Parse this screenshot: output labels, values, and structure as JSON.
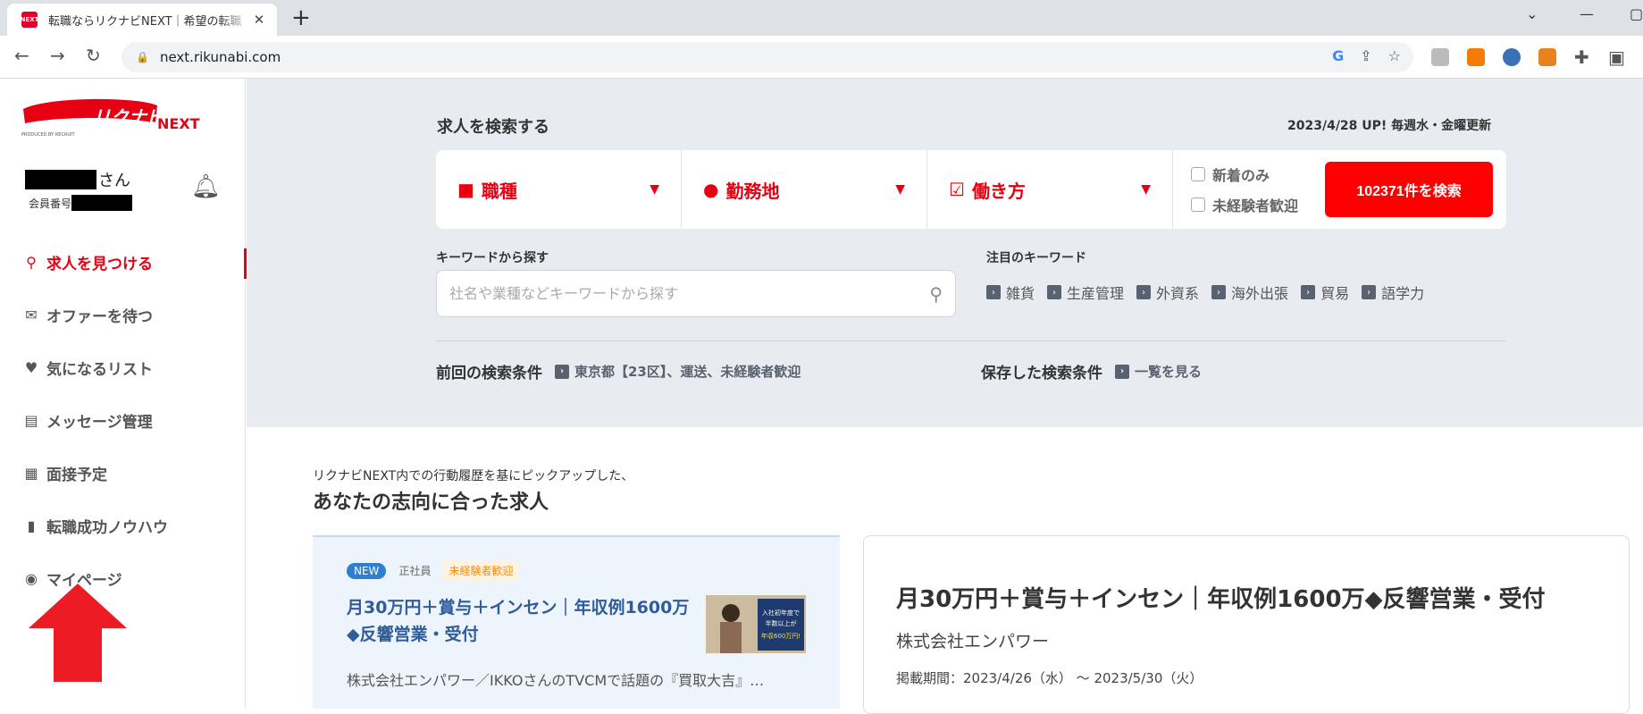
{
  "browser": {
    "tab_favicon_text": "NEXT",
    "tab_title": "転職ならリクナビNEXT｜希望の転職",
    "tab_close": "✕",
    "new_tab": "+",
    "url": "next.rikunabi.com"
  },
  "sidebar": {
    "logo_text": "リクナビ",
    "logo_suffix": "NEXT",
    "logo_tag": "PRODUCED BY RECRUIT",
    "user_suffix": "さん",
    "member_label": "会員番号",
    "menu": [
      {
        "label": "求人を見つける",
        "icon": "search-icon",
        "active": true
      },
      {
        "label": "オファーを待つ",
        "icon": "mail-icon",
        "active": false
      },
      {
        "label": "気になるリスト",
        "icon": "heart-icon",
        "active": false
      },
      {
        "label": "メッセージ管理",
        "icon": "message-icon",
        "active": false
      },
      {
        "label": "面接予定",
        "icon": "calendar-icon",
        "active": false
      },
      {
        "label": "転職成功ノウハウ",
        "icon": "book-icon",
        "active": false
      },
      {
        "label": "マイページ",
        "icon": "user-icon",
        "active": false
      }
    ]
  },
  "search": {
    "heading": "求人を検索する",
    "update_note": "2023/4/28 UP! 毎週水・金曜更新",
    "selectors": [
      {
        "label": "職種",
        "icon": "briefcase-icon"
      },
      {
        "label": "勤務地",
        "icon": "location-pin-icon"
      },
      {
        "label": "働き方",
        "icon": "clipboard-check-icon"
      }
    ],
    "checks": [
      "新着のみ",
      "未経験者歓迎"
    ],
    "button": "102371件を検索",
    "keyword_label": "キーワードから探す",
    "keyword_placeholder": "社名や業種などキーワードから探す",
    "hot_label": "注目のキーワード",
    "hot_keywords": [
      "雑貨",
      "生産管理",
      "外資系",
      "海外出張",
      "貿易",
      "語学力"
    ],
    "prev_label": "前回の検索条件",
    "prev_value": "東京都【23区】、運送、未経験者歓迎",
    "saved_label": "保存した検索条件",
    "saved_link": "一覧を見る"
  },
  "recommend": {
    "subtitle": "リクナビNEXT内での行動履歴を基にピックアップした、",
    "title": "あなたの志向に合った求人",
    "card": {
      "tag_new": "NEW",
      "tag_type": "正社員",
      "tag_inexp": "未経験者歓迎",
      "title": "月30万円＋賞与＋インセン｜年収例1600万◆反響営業・受付",
      "desc": "株式会社エンパワー／IKKOさんのTVCMで話題の『買取大吉』…",
      "thumb_line1": "入社初年度で",
      "thumb_line2": "半数以上が",
      "thumb_line3": "年収600万円!"
    },
    "detail": {
      "title": "月30万円＋賞与＋インセン｜年収例1600万◆反響営業・受付",
      "company": "株式会社エンパワー",
      "period": "掲載期間：2023/4/26（水） 〜 2023/5/30（火）"
    }
  }
}
